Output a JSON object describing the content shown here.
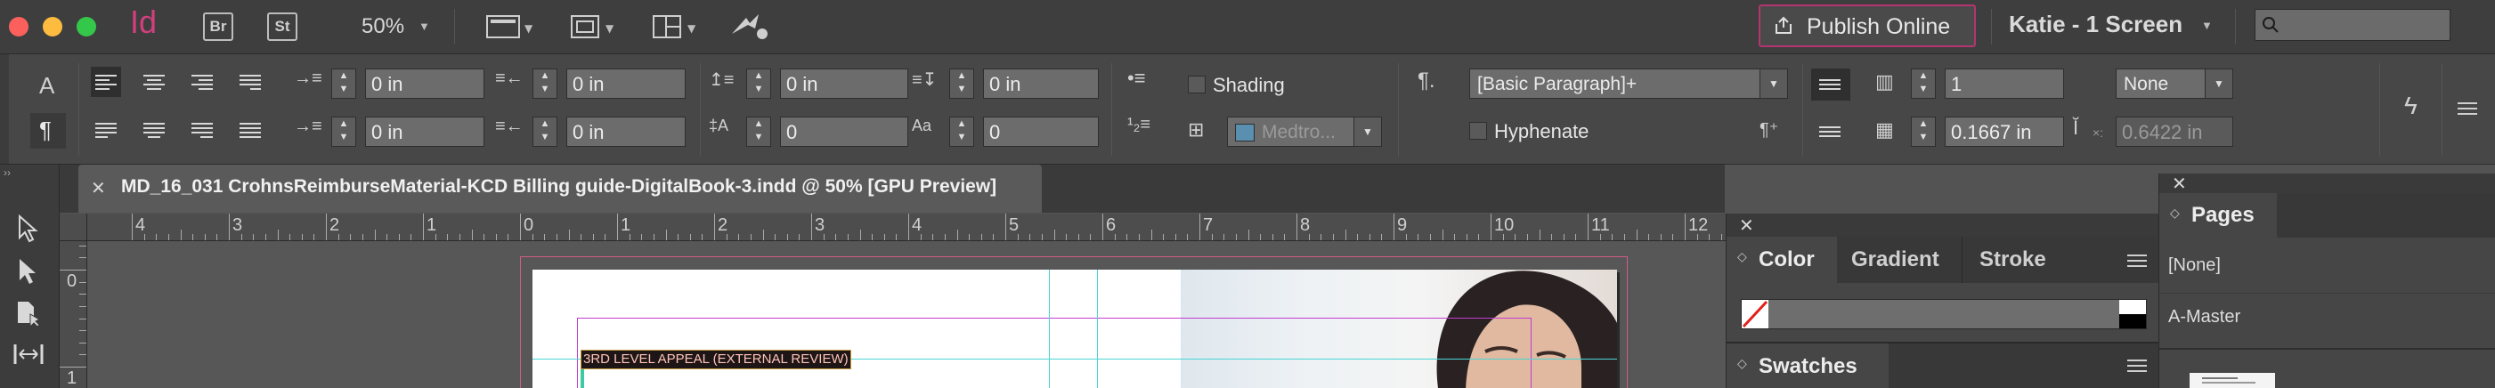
{
  "app": {
    "logo": "Id",
    "bridge_label": "Br",
    "stock_label": "St",
    "zoom": "50%",
    "publish_label": "Publish Online",
    "workspace": "Katie - 1 Screen",
    "search_placeholder": ""
  },
  "colors": {
    "accent": "#d13f7e",
    "red": "#fc605c",
    "yellow": "#fdbc40",
    "green": "#34c84a",
    "guide": "#48d6d6",
    "margin": "#c43bd1"
  },
  "control": {
    "left_indent": "0 in",
    "right_indent": "0 in",
    "first_line_indent": "0 in",
    "last_line_indent": "0 in",
    "space_before": "0 in",
    "space_after": "0 in",
    "dropcap_lines": "0",
    "dropcap_chars": "0",
    "shading_label": "Shading",
    "shading_swatch": "Medtro...",
    "paragraph_style": "[Basic Paragraph]+",
    "hyphenate_label": "Hyphenate",
    "columns": "1",
    "column_gutter": "0.1667 in",
    "span": "None",
    "width_value": "0.6422 in"
  },
  "document": {
    "tab_title": "MD_16_031 CrohnsReimburseMaterial-KCD Billing guide-DigitalBook-3.indd @ 50% [GPU Preview]",
    "text_frame": "3RD LEVEL APPEAL (EXTERNAL REVIEW)"
  },
  "ruler": {
    "h_labels": [
      "4",
      "3",
      "2",
      "1",
      "0",
      "1",
      "2",
      "3",
      "4",
      "5",
      "6",
      "7",
      "8",
      "9",
      "10",
      "11",
      "12"
    ],
    "v_labels": [
      "0",
      "1"
    ]
  },
  "color_panel": {
    "tabs": [
      "Color",
      "Gradient",
      "Stroke"
    ],
    "swatches_label": "Swatches"
  },
  "pages_panel": {
    "title": "Pages",
    "items": [
      "[None]",
      "A-Master"
    ]
  }
}
